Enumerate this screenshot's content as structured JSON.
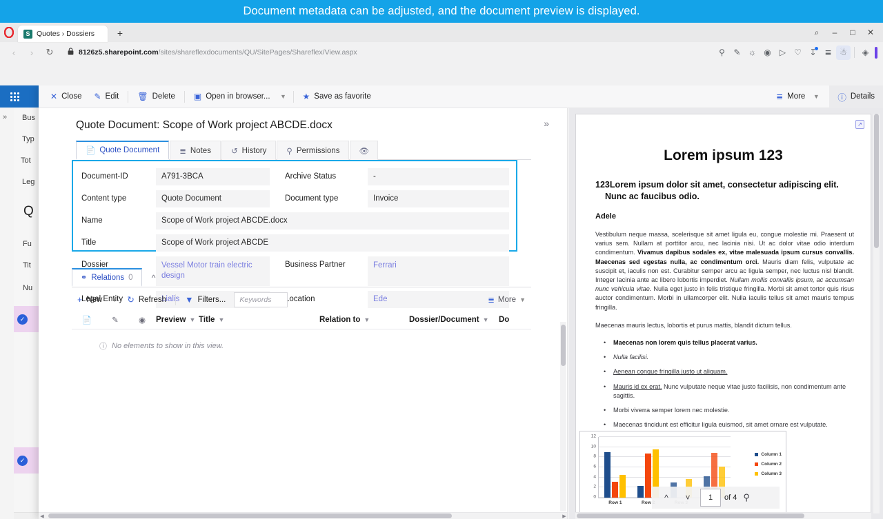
{
  "caption": {
    "text": "Document metadata can be adjusted, and the document preview is displayed."
  },
  "browser": {
    "tab": {
      "title": "Quotes › Dossiers",
      "favicon_letter": "S"
    },
    "newtab_label": "+",
    "window_controls": {
      "search": "⌕",
      "minimize": "–",
      "maximize": "□",
      "close": "✕"
    },
    "nav": {
      "back": "‹",
      "forward": "›",
      "reload": "↻"
    },
    "address": {
      "lock": "🔒",
      "domain": "8126z5.sharepoint.com",
      "path": "/sites/shareflexdocuments/QU/SitePages/Shareflex/View.aspx"
    },
    "toolbar_icons": [
      "search-icon",
      "screenshot-icon",
      "camera-icon",
      "shield-icon",
      "player-icon",
      "heart-icon",
      "downloads-icon",
      "list-icon",
      "profile-icon",
      "workspaces-icon"
    ]
  },
  "command_bar": {
    "clipped_close": "Cl",
    "items": [
      {
        "label": "Close",
        "icon": "close-icon"
      },
      {
        "label": "Edit",
        "icon": "pencil-icon"
      },
      {
        "label": "Delete",
        "icon": "trash-icon"
      },
      {
        "label": "Open in browser...",
        "icon": "open-browser-icon"
      },
      {
        "label": "Save as favorite",
        "icon": "star-icon"
      }
    ],
    "more_label": "More",
    "details_label": "Details"
  },
  "document": {
    "title": "Quote Document: Scope of Work project ABCDE.docx",
    "tabs": [
      {
        "label": "Quote Document",
        "icon": "document-icon",
        "selected": true
      },
      {
        "label": "Notes",
        "icon": "notes-icon",
        "selected": false
      },
      {
        "label": "History",
        "icon": "history-icon",
        "selected": false
      },
      {
        "label": "Permissions",
        "icon": "key-icon",
        "selected": false
      },
      {
        "label": "",
        "icon": "hidden-eye-icon",
        "selected": false
      }
    ],
    "fields": {
      "document_id_label": "Document-ID",
      "document_id_value": "A791-3BCA",
      "archive_status_label": "Archive Status",
      "archive_status_value": "-",
      "content_type_label": "Content type",
      "content_type_value": "Quote Document",
      "document_type_label": "Document type",
      "document_type_value": "Invoice",
      "name_label": "Name",
      "name_value": "Scope of Work project ABCDE.docx",
      "title_label": "Title",
      "title_value": "Scope of Work project ABCDE",
      "dossier_label": "Dossier",
      "dossier_value": "Vessel Motor train electric design",
      "business_partner_label": "Business Partner",
      "business_partner_value": "Ferrari",
      "legal_entity_label": "Legal Entity",
      "legal_entity_value": "Lialis",
      "location_label": "Location",
      "location_value": "Ede"
    }
  },
  "relations": {
    "tab_label": "Relations",
    "tab_count": "0",
    "toolbar": {
      "new_label": "New",
      "refresh_label": "Refresh",
      "filters_label": "Filters...",
      "keywords_placeholder": "Keywords",
      "more_label": "More"
    },
    "columns": [
      "Preview",
      "Title",
      "Relation to",
      "Dossier/Document",
      "Do"
    ],
    "empty_message": "No elements to show in this view."
  },
  "preview": {
    "heading": "Lorem ipsum 123",
    "subheading": "123Lorem ipsum dolor sit amet, consectetur adipiscing elit. Nunc ac faucibus odio.",
    "author": "Adele",
    "paragraph_1_a": "Vestibulum neque massa, scelerisque sit amet ligula eu, congue molestie mi. Praesent ut varius sem. Nullam at porttitor arcu, nec lacinia nisi. Ut ac dolor vitae odio interdum condimentum. ",
    "paragraph_1_bold": "Vivamus dapibus sodales ex, vitae malesuada ipsum cursus convallis. Maecenas sed egestas nulla, ac condimentum orci.",
    "paragraph_1_b": " Mauris diam felis, vulputate ac suscipit et, iaculis non est. Curabitur semper arcu ac ligula semper, nec luctus nisl blandit. Integer lacinia ante ac libero lobortis imperdiet. ",
    "paragraph_1_italic": "Nullam mollis convallis ipsum, ac accumsan nunc vehicula vitae.",
    "paragraph_1_c": " Nulla eget justo in felis tristique fringilla. Morbi sit amet tortor quis risus auctor condimentum. Morbi in ullamcorper elit. Nulla iaculis tellus sit amet mauris tempus fringilla.",
    "paragraph_2": "Maecenas mauris lectus, lobortis et purus mattis, blandit dictum tellus.",
    "bullets": [
      {
        "bold": "Maecenas non lorem quis tellus placerat varius.",
        "italic": "",
        "underline": "",
        "plain": ""
      },
      {
        "bold": "",
        "italic": "Nulla facilisi.",
        "underline": "",
        "plain": ""
      },
      {
        "bold": "",
        "italic": "",
        "underline": "Aenean congue fringilla justo ut aliquam.",
        "plain": ""
      },
      {
        "bold": "",
        "italic": "",
        "underline": "Mauris id ex erat.",
        "plain": " Nunc vulputate neque vitae justo facilisis, non condimentum ante sagittis."
      },
      {
        "bold": "",
        "italic": "",
        "underline": "",
        "plain": "Morbi viverra semper lorem nec molestie."
      },
      {
        "bold": "",
        "italic": "",
        "underline": "",
        "plain": "Maecenas tincidunt est efficitur ligula euismod, sit amet ornare est vulputate."
      }
    ],
    "pager": {
      "page": "1",
      "of_label": "of 4",
      "up_icon": "chevron-up-icon",
      "down_icon": "chevron-down-icon",
      "zoom_icon": "zoom-in-icon"
    },
    "popout_icon": "pop-out-icon"
  },
  "chart_data": {
    "type": "bar",
    "title": "",
    "categories": [
      "Row 1",
      "Row 2",
      "Row 3",
      "Row 4"
    ],
    "series": [
      {
        "name": "Column 1",
        "color": "#1f4e8c",
        "values": [
          9.0,
          2.35,
          3.05,
          4.25
        ]
      },
      {
        "name": "Column 2",
        "color": "#f4460d",
        "values": [
          3.2,
          8.7,
          0.0,
          8.9
        ]
      },
      {
        "name": "Column 3",
        "color": "#ffc000",
        "values": [
          4.45,
          9.55,
          3.7,
          6.1
        ]
      }
    ],
    "ylim": [
      0,
      12
    ],
    "yticks": [
      0,
      2,
      4,
      6,
      8,
      10,
      12
    ],
    "xlabel": "",
    "ylabel": "",
    "grid": true,
    "legend_position": "right"
  },
  "background_app": {
    "labels": [
      "Bus",
      "Typ",
      "Tot",
      "Leg",
      "Fu",
      "Tit",
      "Nu",
      "Bu"
    ],
    "big_letter": "Q"
  }
}
